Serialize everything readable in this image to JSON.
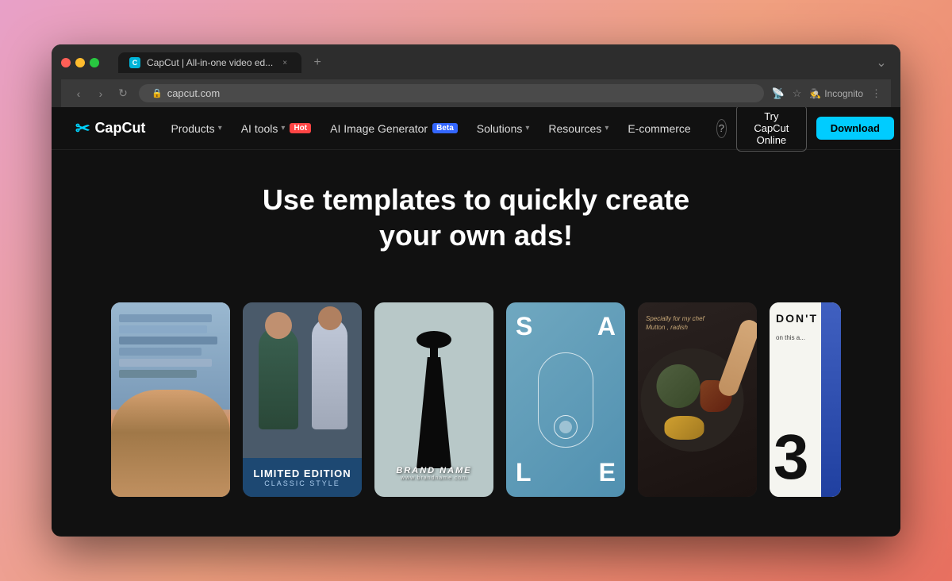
{
  "browser": {
    "tab_title": "CapCut | All-in-one video ed...",
    "tab_close": "×",
    "tab_new": "+",
    "tab_expand": "⌄",
    "nav_back": "‹",
    "nav_forward": "›",
    "nav_refresh": "↻",
    "url": "capcut.com",
    "addr_icons": [
      "🔒",
      "☆"
    ],
    "incognito_label": "Incognito",
    "kebab_menu": "⋮"
  },
  "navbar": {
    "logo_icon": "✂",
    "logo_text": "CapCut",
    "products_label": "Products",
    "ai_tools_label": "AI tools",
    "hot_badge": "Hot",
    "ai_image_label": "AI Image Generator",
    "beta_badge": "Beta",
    "solutions_label": "Solutions",
    "resources_label": "Resources",
    "ecommerce_label": "E-commerce",
    "help_icon": "?",
    "try_online_label": "Try CapCut Online",
    "download_label": "Download"
  },
  "hero": {
    "title": "Use templates to quickly create your own ads!"
  },
  "cards": [
    {
      "id": "card-fashion-blue",
      "type": "fashion",
      "overlay_title": "",
      "overlay_subtitle": ""
    },
    {
      "id": "card-limited-edition",
      "type": "group-fashion",
      "overlay_title": "LIMITED EDITION",
      "overlay_subtitle": "CLASSIC STYLE"
    },
    {
      "id": "card-brand-name",
      "type": "dress",
      "brand_main": "BRAND NAME",
      "brand_url": "www.brandname.com"
    },
    {
      "id": "card-sale",
      "type": "jewelry",
      "sale_letters": [
        "S",
        "A",
        "L",
        "E"
      ]
    },
    {
      "id": "card-food",
      "type": "food",
      "restaurant_tag": "Specially for my chef",
      "food_label": "Mutton , radish"
    },
    {
      "id": "card-dont",
      "type": "magazine",
      "dont_text": "DON'T",
      "sub_text": "on this a...",
      "number": "3"
    }
  ]
}
